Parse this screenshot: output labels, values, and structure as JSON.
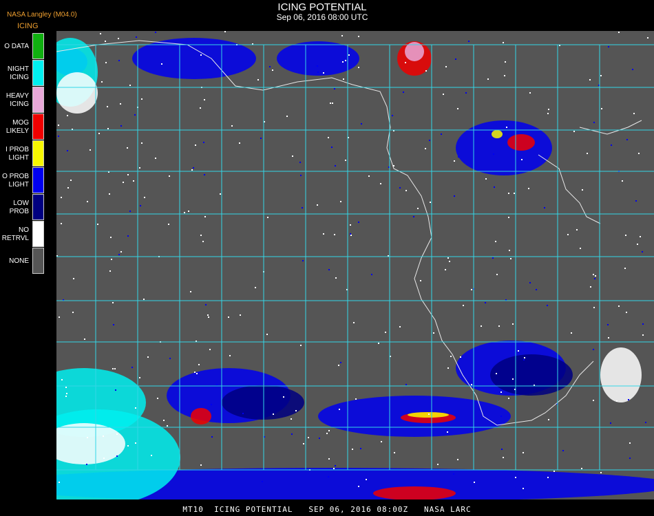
{
  "header": {
    "org": "NASA Langley (M04.0)",
    "product": "ICING",
    "title": "ICING POTENTIAL",
    "subtitle": "Sep 06, 2016 08:00 UTC"
  },
  "legend": [
    {
      "label": "O DATA",
      "color": "#10b010"
    },
    {
      "label": "NIGHT\nICING",
      "color": "#00f0f0"
    },
    {
      "label": "HEAVY\nICING",
      "color": "#e8a8d8"
    },
    {
      "label": "MOG\nLIKELY",
      "color": "#f00000"
    },
    {
      "label": "I PROB\nLIGHT",
      "color": "#f8f800"
    },
    {
      "label": "O PROB\nLIGHT",
      "color": "#0000f0"
    },
    {
      "label": "LOW\nPROB",
      "color": "#000080"
    },
    {
      "label": "NO\nRETRVL",
      "color": "#ffffff"
    },
    {
      "label": "NONE",
      "color": "#555555"
    }
  ],
  "map": {
    "background": "#555555",
    "grid_color": "#33d6e6",
    "coast_color": "#e8e8e8",
    "label_color": "#c03030"
  },
  "footer": "MT10  ICING POTENTIAL   SEP 06, 2016 08:00Z   NASA LARC"
}
